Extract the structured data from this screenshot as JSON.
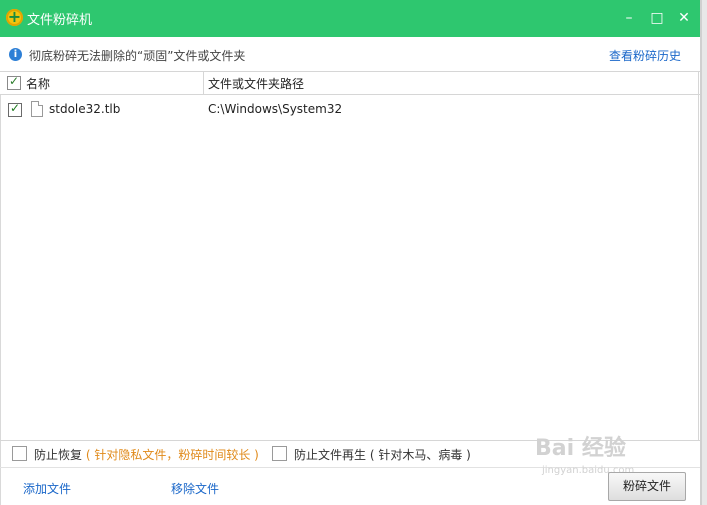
{
  "window": {
    "title": "文件粉碎机",
    "controls": [
      "minimize-icon",
      "maximize-icon",
      "close-icon"
    ]
  },
  "infobar": {
    "text": "彻底粉碎无法删除的“顽固”文件或文件夹",
    "history_link": "查看粉碎历史"
  },
  "table": {
    "headers": {
      "name": "名称",
      "path": "文件或文件夹路径"
    },
    "rows": [
      {
        "checked": true,
        "name": "stdole32.tlb",
        "path": "C:\\Windows\\System32"
      }
    ]
  },
  "options": {
    "prevent_recovery": {
      "label": "防止恢复",
      "hint": "( 针对隐私文件，粉碎时间较长 )",
      "checked": false
    },
    "prevent_regen": {
      "label": "防止文件再生",
      "hint": "( 针对木马、病毒 )",
      "checked": false
    }
  },
  "actions": {
    "add_file": "添加文件",
    "remove_file": "移除文件",
    "shred_button": "粉碎文件"
  },
  "watermark": {
    "brand": "Bai 经验",
    "url": "jingyan.baidu.com"
  },
  "colors": {
    "titlebar": "#2ec76f",
    "link": "#1a67c9",
    "hint": "#e08a1a"
  }
}
